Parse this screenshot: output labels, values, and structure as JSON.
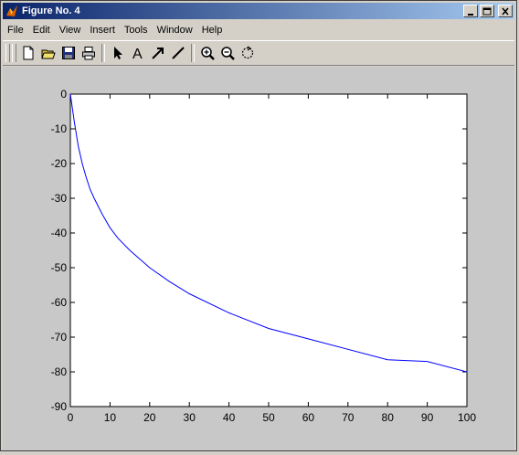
{
  "window": {
    "title": "Figure No. 4"
  },
  "menu": [
    "File",
    "Edit",
    "View",
    "Insert",
    "Tools",
    "Window",
    "Help"
  ],
  "toolbar_icons": [
    "new-file-icon",
    "open-folder-icon",
    "save-icon",
    "print-icon",
    "pointer-arrow-icon",
    "text-tool-icon",
    "arrow-tool-icon",
    "line-tool-icon",
    "zoom-in-icon",
    "zoom-out-icon",
    "rotate-icon"
  ],
  "colors": {
    "titlebar_start": "#0a246a",
    "titlebar_end": "#a6caf0",
    "line": "#0000ff",
    "figure_bg": "#c8c8c8"
  },
  "chart_data": {
    "type": "line",
    "title": "",
    "xlabel": "",
    "ylabel": "",
    "xlim": [
      0,
      100
    ],
    "ylim": [
      -90,
      0
    ],
    "xticks": [
      0,
      10,
      20,
      30,
      40,
      50,
      60,
      70,
      80,
      90,
      100
    ],
    "yticks": [
      0,
      -10,
      -20,
      -30,
      -40,
      -50,
      -60,
      -70,
      -80,
      -90
    ],
    "series": [
      {
        "x": [
          0,
          1,
          2,
          3,
          4,
          5,
          6,
          8,
          10,
          12,
          15,
          20,
          25,
          30,
          40,
          50,
          60,
          70,
          80,
          90,
          100
        ],
        "y": [
          0,
          -8,
          -15,
          -20,
          -24,
          -27.5,
          -30,
          -34.5,
          -38.5,
          -41.5,
          -45,
          -50,
          -54,
          -57.5,
          -63,
          -67.5,
          -70.5,
          -73.5,
          -76.5,
          -77,
          -80
        ]
      }
    ]
  }
}
